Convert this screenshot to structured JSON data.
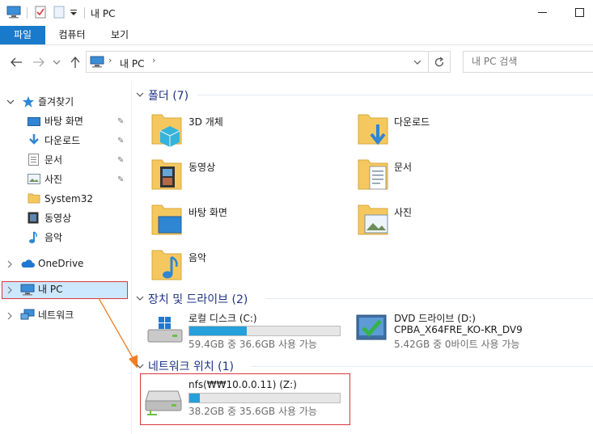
{
  "window": {
    "title": "내 PC"
  },
  "ribbon": {
    "tabs": [
      "파일",
      "컴퓨터",
      "보기"
    ]
  },
  "address": {
    "location": "내 PC",
    "search_placeholder": "내 PC 검색"
  },
  "sidebar": {
    "quick_access": "즐겨찾기",
    "quick_items": [
      "바탕 화면",
      "다운로드",
      "문서",
      "사진",
      "System32",
      "동영상",
      "음악"
    ],
    "onedrive": "OneDrive",
    "this_pc": "내 PC",
    "network": "네트워크"
  },
  "sections": {
    "folders": "폴더 (7)",
    "devices": "장치 및 드라이브 (2)",
    "network_locations": "네트워크 위치 (1)"
  },
  "folders": [
    "3D 개체",
    "다운로드",
    "동영상",
    "문서",
    "바탕 화면",
    "사진",
    "음악"
  ],
  "drives": {
    "local": {
      "name": "로컬 디스크 (C:)",
      "space": "59.4GB 중 36.6GB 사용 가능",
      "used_fraction": 0.38
    },
    "dvd": {
      "name": "DVD 드라이브 (D:)",
      "label": "CPBA_X64FRE_KO-KR_DV9",
      "space": "5.42GB 중 0바이트 사용 가능"
    },
    "nfs": {
      "name": "nfs(₩₩10.0.0.11) (Z:)",
      "space": "38.2GB 중 35.6GB 사용 가능",
      "used_fraction": 0.07
    }
  },
  "colors": {
    "accent": "#1979ca",
    "bar_fill": "#26a0da",
    "annotation": "#d9363e",
    "arrow": "#f07e26",
    "section": "#1e3287"
  }
}
